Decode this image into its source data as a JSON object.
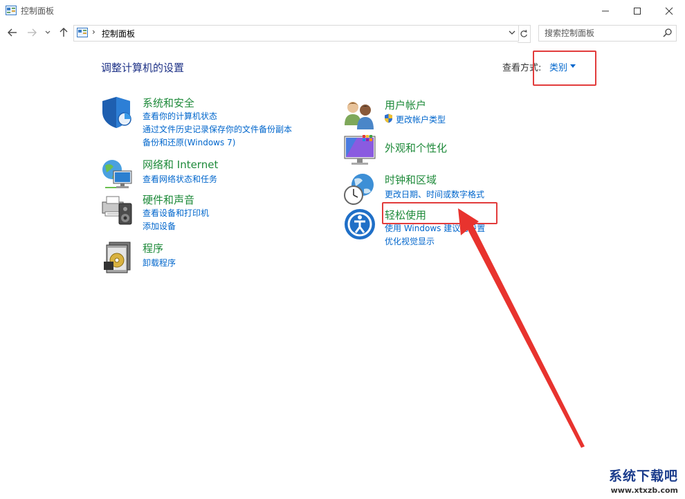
{
  "window": {
    "title": "控制面板"
  },
  "address": {
    "crumb": "控制面板",
    "search_placeholder": "搜索控制面板"
  },
  "header": {
    "title": "调整计算机的设置",
    "view_by_label": "查看方式:",
    "view_by_value": "类别"
  },
  "categories": {
    "system": {
      "title": "系统和安全",
      "links": [
        "查看你的计算机状态",
        "通过文件历史记录保存你的文件备份副本",
        "备份和还原(Windows 7)"
      ]
    },
    "network": {
      "title": "网络和 Internet",
      "links": [
        "查看网络状态和任务"
      ]
    },
    "hardware": {
      "title": "硬件和声音",
      "links": [
        "查看设备和打印机",
        "添加设备"
      ]
    },
    "programs": {
      "title": "程序",
      "links": [
        "卸载程序"
      ]
    },
    "users": {
      "title": "用户帐户",
      "links": [
        "更改帐户类型"
      ]
    },
    "appearance": {
      "title": "外观和个性化",
      "links": []
    },
    "clock": {
      "title": "时钟和区域",
      "links": [
        "更改日期、时间或数字格式"
      ]
    },
    "ease": {
      "title": "轻松使用",
      "links": [
        "使用 Windows 建议的设置",
        "优化视觉显示"
      ]
    }
  },
  "watermark": {
    "line1": "系统下载吧",
    "line2": "www.xtxzb.com"
  },
  "colors": {
    "category_title": "#1e8a3a",
    "link": "#0066cc",
    "page_title": "#1e3287",
    "annotation": "#e23b3b"
  }
}
